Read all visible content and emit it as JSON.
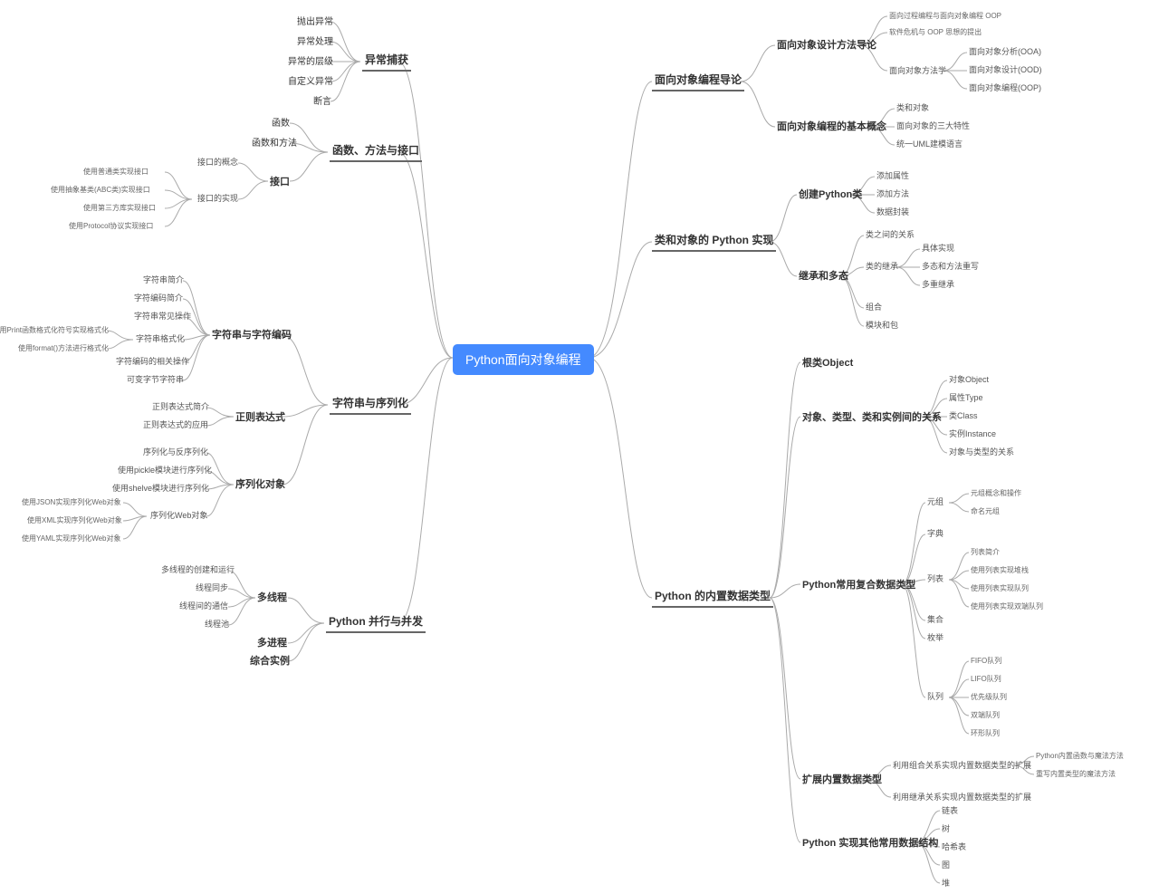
{
  "root": "Python面向对象编程",
  "left": {
    "exc": {
      "title": "异常捕获",
      "items": [
        "抛出异常",
        "异常处理",
        "异常的层级",
        "自定义异常",
        "断言"
      ]
    },
    "func": {
      "title": "函数、方法与接口",
      "n1": "函数",
      "n2": "函数和方法",
      "n3": "接口",
      "n3a": "接口的概念",
      "n3b": "接口的实现",
      "impl": [
        "使用普通类实现接口",
        "使用抽象基类(ABC类)实现接口",
        "使用第三方库实现接口",
        "使用Protocol协议实现接口"
      ]
    },
    "str": {
      "title": "字符串与序列化",
      "s1": "字符串与字符编码",
      "s1items": [
        "字符串简介",
        "字符编码简介",
        "字符串常见操作",
        "字符串格式化",
        "字符编码的相关操作",
        "可变字节字符串"
      ],
      "s1fmt": [
        "使用Print函数格式化符号实现格式化",
        "使用format()方法进行格式化"
      ],
      "s2": "正则表达式",
      "s2items": [
        "正则表达式简介",
        "正则表达式的应用"
      ],
      "s3": "序列化对象",
      "s3items": [
        "序列化与反序列化",
        "使用pickle模块进行序列化",
        "使用shelve模块进行序列化",
        "序列化Web对象"
      ],
      "s3web": [
        "使用JSON实现序列化Web对象",
        "使用XML实现序列化Web对象",
        "使用YAML实现序列化Web对象"
      ]
    },
    "par": {
      "title": "Python 并行与并发",
      "p1": "多线程",
      "p1items": [
        "多线程的创建和运行",
        "线程同步",
        "线程间的通信",
        "线程池"
      ],
      "p2": "多进程",
      "p3": "综合实例"
    }
  },
  "right": {
    "intro": {
      "title": "面向对象编程导论",
      "a": "面向对象设计方法导论",
      "a1": "面向过程编程与面向对象编程 OOP",
      "a2": "软件危机与 OOP 思想的提出",
      "a3": "面向对象方法学",
      "a3items": [
        "面向对象分析(OOA)",
        "面向对象设计(OOD)",
        "面向对象编程(OOP)"
      ],
      "b": "面向对象编程的基本概念",
      "bitems": [
        "类和对象",
        "面向对象的三大特性",
        "统一UML建模语言"
      ]
    },
    "cls": {
      "title": "类和对象的 Python 实现",
      "c1": "创建Python类",
      "c1items": [
        "添加属性",
        "添加方法",
        "数据封装"
      ],
      "c2": "继承和多态",
      "c2a": "类之间的关系",
      "c2b": "类的继承",
      "c2bitems": [
        "具体实现",
        "多态和方法重写",
        "多重继承"
      ],
      "c2c": "组合",
      "c2d": "模块和包"
    },
    "dt": {
      "title": "Python 的内置数据类型",
      "d1": "根类Object",
      "d2": "对象、类型、类和实例间的关系",
      "d2items": [
        "对象Object",
        "属性Type",
        "类Class",
        "实例Instance",
        "对象与类型的关系"
      ],
      "d3": "Python常用复合数据类型",
      "d3t": "元组",
      "d3titems": [
        "元组概念和操作",
        "命名元组"
      ],
      "d3d": "字典",
      "d3l": "列表",
      "d3litems": [
        "列表简介",
        "使用列表实现堆栈",
        "使用列表实现队列",
        "使用列表实现双端队列"
      ],
      "d3s": "集合",
      "d3e": "枚举",
      "d3q": "队列",
      "d3qitems": [
        "FIFO队列",
        "LIFO队列",
        "优先级队列",
        "双端队列",
        "环形队列"
      ],
      "d4": "扩展内置数据类型",
      "d4a": "利用组合关系实现内置数据类型的扩展",
      "d4aitems": [
        "Python内置函数与魔法方法",
        "重写内置类型的魔法方法"
      ],
      "d4b": "利用继承关系实现内置数据类型的扩展",
      "d5": "Python 实现其他常用数据结构",
      "d5items": [
        "链表",
        "树",
        "哈希表",
        "图",
        "堆"
      ]
    }
  }
}
